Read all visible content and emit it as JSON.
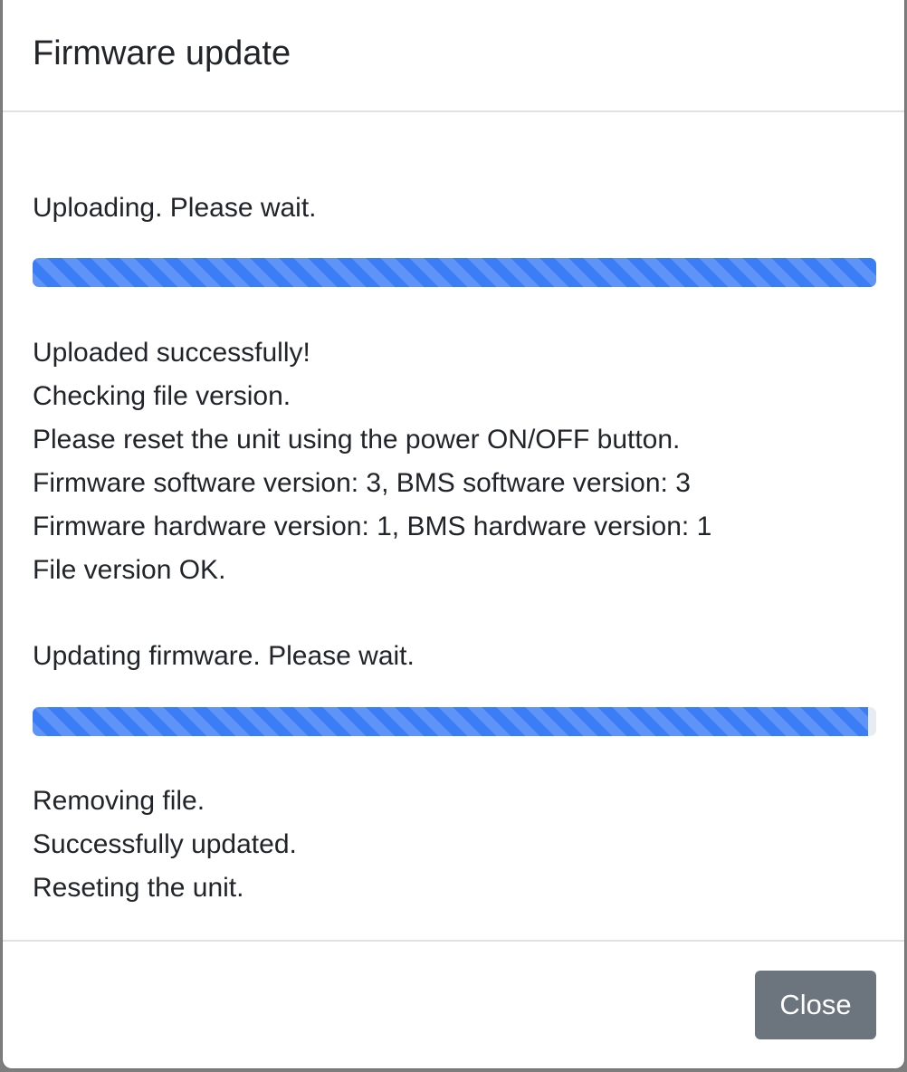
{
  "modal": {
    "title": "Firmware update",
    "close_label": "Close"
  },
  "upload": {
    "status": "Uploading. Please wait.",
    "progress_percent": 100,
    "messages": [
      "Uploaded successfully!",
      "Checking file version.",
      "Please reset the unit using the power ON/OFF button.",
      "Firmware software version: 3, BMS software version: 3",
      "Firmware hardware version: 1, BMS hardware version: 1",
      "File version OK."
    ]
  },
  "update": {
    "status": "Updating firmware. Please wait.",
    "progress_percent": 99,
    "messages": [
      "Removing file.",
      "Successfully updated.",
      "Reseting the unit."
    ]
  },
  "colors": {
    "progress_fill": "#3b7df5",
    "progress_track": "#e9ecef",
    "button_secondary": "#6c757d"
  }
}
